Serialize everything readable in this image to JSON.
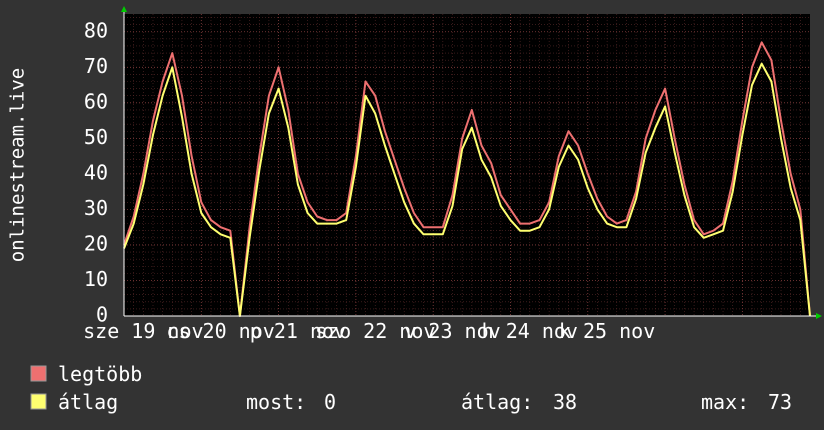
{
  "chart_data": {
    "type": "line",
    "ylabel": "onlinestream.live",
    "ylim": [
      0,
      85
    ],
    "y_ticks": [
      0,
      10,
      20,
      30,
      40,
      50,
      60,
      70,
      80
    ],
    "x_day_labels": [
      "sze 19 nov",
      "cs 20 nov",
      "p 21 nov",
      "szo 22 nov",
      "v 23 nov",
      "h 24 nov",
      "k 25 nov"
    ],
    "grid": true,
    "x_hours": [
      0,
      3,
      6,
      9,
      12,
      15,
      18,
      21,
      24,
      27,
      30,
      33,
      36,
      39,
      42,
      45,
      48,
      51,
      54,
      57,
      60,
      63,
      66,
      69,
      72,
      75,
      78,
      81,
      84,
      87,
      90,
      93,
      96,
      99,
      102,
      105,
      108,
      111,
      114,
      117,
      120,
      123,
      126,
      129,
      132,
      135,
      138,
      141,
      144,
      147,
      150,
      153,
      156,
      159,
      162,
      165,
      168,
      171,
      174,
      177,
      180,
      183,
      186,
      189
    ],
    "series": [
      {
        "name": "legtöbb",
        "color": "#ee7070",
        "values": [
          20,
          28,
          40,
          55,
          66,
          74,
          62,
          45,
          32,
          27,
          25,
          24,
          0,
          25,
          45,
          62,
          70,
          58,
          40,
          32,
          28,
          27,
          27,
          29,
          45,
          66,
          62,
          52,
          44,
          36,
          29,
          25,
          25,
          25,
          34,
          50,
          58,
          48,
          43,
          34,
          30,
          26,
          26,
          27,
          32,
          45,
          52,
          48,
          40,
          33,
          28,
          26,
          27,
          35,
          50,
          58,
          64,
          50,
          37,
          27,
          23,
          24,
          26,
          38
        ],
        "tail": [
          55,
          70,
          77,
          72,
          55,
          40,
          30,
          0
        ]
      },
      {
        "name": "átlag",
        "color": "#ffff70",
        "values": [
          19,
          26,
          37,
          51,
          62,
          70,
          56,
          40,
          29,
          25,
          23,
          22,
          0,
          22,
          41,
          57,
          64,
          53,
          37,
          29,
          26,
          26,
          26,
          27,
          42,
          62,
          57,
          48,
          40,
          32,
          26,
          23,
          23,
          23,
          31,
          47,
          53,
          44,
          39,
          31,
          27,
          24,
          24,
          25,
          30,
          42,
          48,
          44,
          36,
          30,
          26,
          25,
          25,
          33,
          46,
          53,
          59,
          46,
          34,
          25,
          22,
          23,
          24,
          35
        ],
        "tail": [
          51,
          65,
          71,
          66,
          50,
          36,
          27,
          0
        ]
      }
    ],
    "legend": [
      {
        "label": "legtöbb",
        "color": "#ee7070"
      },
      {
        "label": "átlag",
        "color": "#ffff70"
      }
    ],
    "stats": [
      {
        "label": "most:",
        "value": "0"
      },
      {
        "label": "átlag:",
        "value": "38"
      },
      {
        "label": "max:",
        "value": "73"
      }
    ]
  }
}
